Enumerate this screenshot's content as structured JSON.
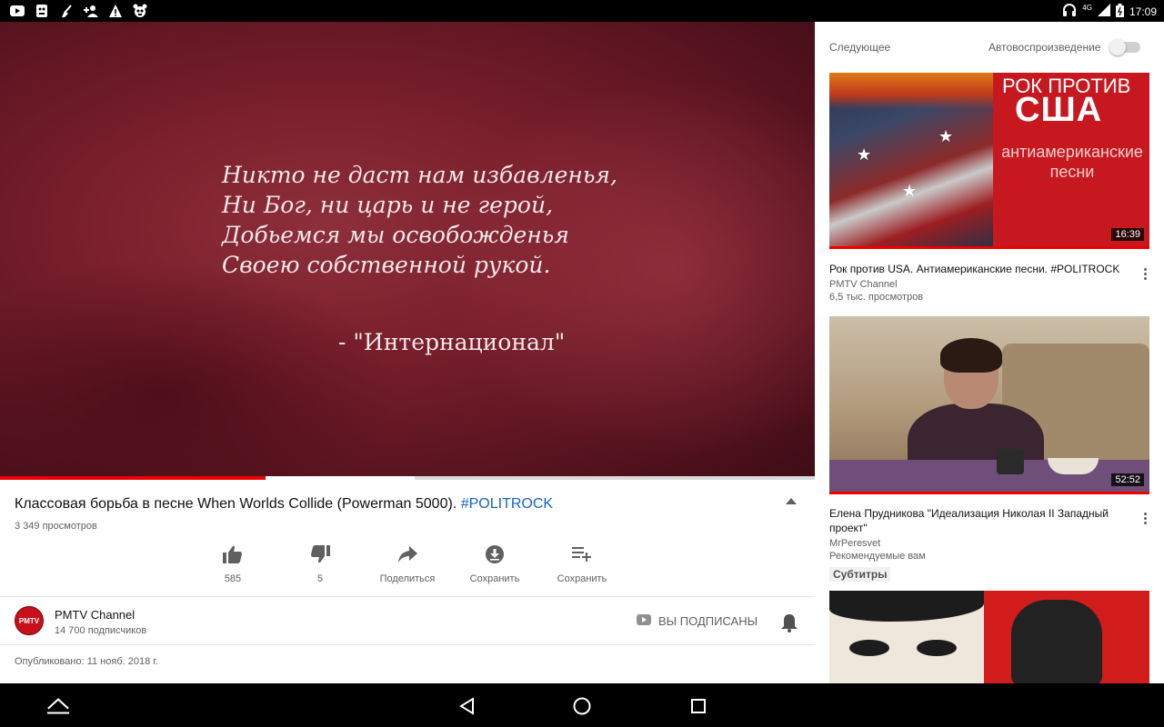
{
  "statusbar": {
    "left_icons": [
      "youtube-icon",
      "app-icon",
      "cleaner-icon",
      "add-person-icon",
      "warning-icon",
      "panda-icon"
    ],
    "network": "4G",
    "time": "17:09"
  },
  "player": {
    "quote_lines": [
      "Никто не даст нам избавленья,",
      "Ни Бог, ни царь и не герой,",
      "Добьемся мы освобожденья",
      "Своею собственной рукой."
    ],
    "quote_attribution": "- \"Интернационал\"",
    "progress_played": 0.326,
    "progress_buffered": 0.509
  },
  "video": {
    "title": "Классовая борьба в песне When Worlds Collide (Powerman 5000).",
    "hashtag": "#POLITROCK",
    "views": "3 349 просмотров",
    "actions": [
      {
        "label": "585",
        "icon": "thumbs-up-icon"
      },
      {
        "label": "5",
        "icon": "thumbs-down-icon"
      },
      {
        "label": "Поделиться",
        "icon": "share-icon"
      },
      {
        "label": "Сохранить",
        "icon": "download-icon"
      },
      {
        "label": "Сохранить",
        "icon": "add-to-playlist-icon"
      }
    ],
    "channel": {
      "name": "PMTV Channel",
      "avatar_text": "PMTV",
      "subscribers": "14 700 подписчиков",
      "subscribed_label": "ВЫ ПОДПИСАНЫ"
    },
    "published": "Опубликовано: 11 нояб. 2018 г."
  },
  "sidebar": {
    "next_label": "Следующее",
    "autoplay_label": "Автовоспроизведение",
    "autoplay_on": false,
    "items": [
      {
        "thumb_text_line1": "РОК ПРОТИВ",
        "thumb_text_line2": "США",
        "thumb_text_line3": "антиамериканские песни",
        "duration": "16:39",
        "title": "Рок против USA. Антиамериканские песни. #POLITROCK",
        "channel": "PMTV Channel",
        "meta": "6,5 тыс. просмотров"
      },
      {
        "duration": "52:52",
        "title": "Елена Прудникова   \"Идеализация Николая II   Западный проект\"",
        "channel": "MrPeresvet",
        "meta": "Рекомендуемые вам",
        "badge": "Субтитры"
      }
    ]
  },
  "navbar": {
    "buttons": [
      "expand-icon",
      "back-icon",
      "home-icon",
      "recents-icon"
    ]
  },
  "colors": {
    "accent_red": "#ff0000",
    "link_blue": "#1565c0",
    "text_secondary": "#606060"
  }
}
